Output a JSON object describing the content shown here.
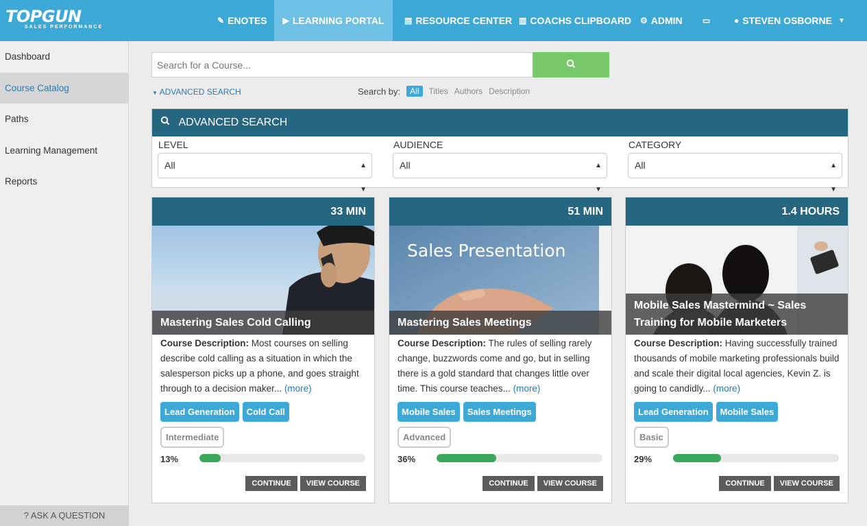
{
  "brand": {
    "name": "TOPGUN",
    "tagline": "SALES PERFORMANCE"
  },
  "topnav": [
    {
      "label": "ENOTES",
      "icon": "pencil-icon",
      "glyph": "✎"
    },
    {
      "label": "LEARNING PORTAL",
      "icon": "play-circle-icon",
      "glyph": "▶"
    },
    {
      "label": "RESOURCE CENTER",
      "icon": "document-icon",
      "glyph": "▤"
    },
    {
      "label": "COACHS CLIPBOARD",
      "icon": "clipboard-icon",
      "glyph": "▥"
    },
    {
      "label": "ADMIN",
      "icon": "cogs-icon",
      "glyph": "⚙"
    },
    {
      "label": "",
      "icon": "inbox-icon",
      "glyph": "▭"
    },
    {
      "label": "STEVEN OSBORNE",
      "icon": "user-icon",
      "glyph": "●"
    }
  ],
  "sidebar": {
    "items": [
      {
        "label": "Dashboard"
      },
      {
        "label": "Course Catalog"
      },
      {
        "label": "Paths"
      },
      {
        "label": "Learning Management"
      },
      {
        "label": "Reports"
      }
    ],
    "ask": "? ASK A QUESTION"
  },
  "search": {
    "placeholder": "Search for a Course...",
    "advanced_link": "ADVANCED SEARCH",
    "searchby_label": "Search by:",
    "options": [
      "All",
      "Titles",
      "Authors",
      "Description"
    ]
  },
  "advanced": {
    "title": "ADVANCED SEARCH",
    "filters": [
      {
        "label": "LEVEL",
        "value": "All"
      },
      {
        "label": "AUDIENCE",
        "value": "All"
      },
      {
        "label": "CATEGORY",
        "value": "All"
      }
    ]
  },
  "courses": [
    {
      "duration": "33 MIN",
      "title": "Mastering Sales Cold Calling",
      "desc_label": "Course Description:",
      "desc": "Most courses on selling describe cold calling as a situation in which the salesperson picks up a phone, and goes straight through to a decision maker...",
      "more": "(more)",
      "tags": [
        "Lead Generation",
        "Cold Call"
      ],
      "level": "Intermediate",
      "progress_label": "13%",
      "progress": 13,
      "continue": "CONTINUE",
      "view": "VIEW COURSE"
    },
    {
      "duration": "51 MIN",
      "title": "Mastering Sales Meetings",
      "image_text": "Sales Presentation",
      "desc_label": "Course Description:",
      "desc": "The rules of selling rarely change, buzzwords come and go, but in selling there is a gold standard that changes little over time. This course teaches...",
      "more": "(more)",
      "tags": [
        "Mobile Sales",
        "Sales Meetings"
      ],
      "level": "Advanced",
      "progress_label": "36%",
      "progress": 36,
      "continue": "CONTINUE",
      "view": "VIEW COURSE"
    },
    {
      "duration": "1.4 HOURS",
      "title": "Mobile Sales Mastermind ~ Sales Training for Mobile Marketers",
      "desc_label": "Course Description:",
      "desc": "Having successfully trained thousands of mobile marketing professionals build and scale their digital local agencies, Kevin Z. is going to candidly...",
      "more": "(more)",
      "tags": [
        "Lead Generation",
        "Mobile Sales"
      ],
      "level": "Basic",
      "progress_label": "29%",
      "progress": 29,
      "continue": "CONTINUE",
      "view": "VIEW COURSE"
    }
  ]
}
